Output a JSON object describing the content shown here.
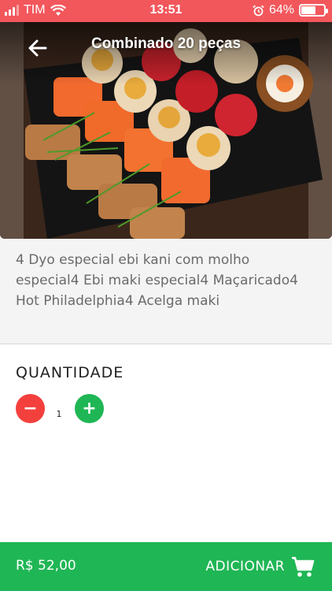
{
  "status_bar": {
    "carrier": "TIM",
    "time": "13:51",
    "battery_percent": "64%",
    "battery_level": 0.64
  },
  "header": {
    "title": "Combinado 20 peças",
    "back_icon": "arrow-left-icon"
  },
  "product": {
    "description": "4 Dyo especial ebi kani com molho especial4 Ebi maki especial4 Maçaricado4 Hot Philadelphia4 Acelga maki"
  },
  "quantity": {
    "title": "QUANTIDADE",
    "minus_label": "−",
    "plus_label": "+",
    "value": "1"
  },
  "footer": {
    "price": "R$ 52,00",
    "add_label": "ADICIONAR",
    "cart_icon": "cart-icon"
  },
  "colors": {
    "status_bar": "#f2575c",
    "accent_green": "#1fb655",
    "minus_red": "#f3403d"
  }
}
